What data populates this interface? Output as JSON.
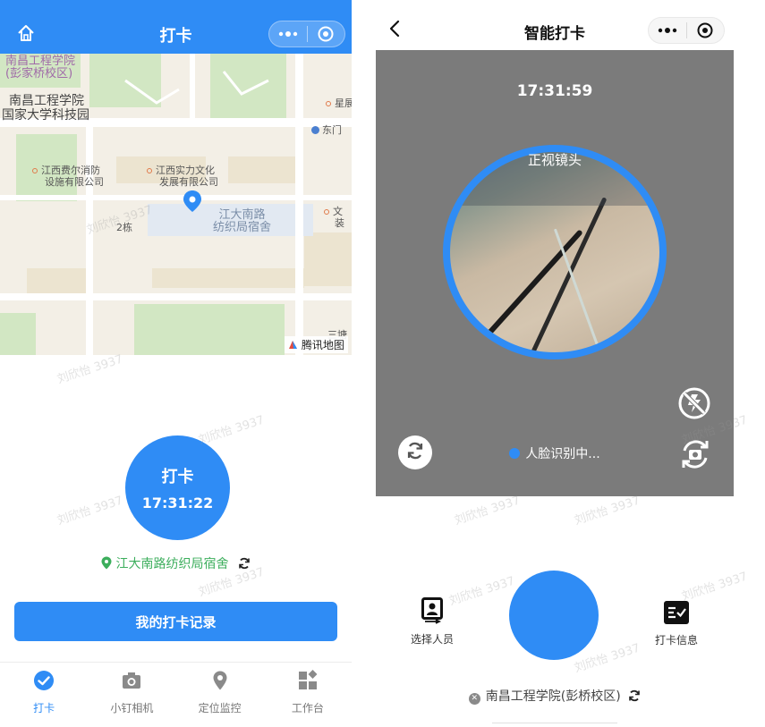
{
  "left": {
    "header": {
      "title": "打卡"
    },
    "map": {
      "labels": {
        "school_top": "南昌工程学院",
        "school_top_sub": "(彭家桥校区)",
        "school": "南昌工程学院",
        "science_park": "国家大学科技园",
        "fire_company_1": "江西费尔消防",
        "fire_company_2": "设施有限公司",
        "culture_company_1": "江西实力文化",
        "culture_company_2": "发展有限公司",
        "dorm_1": "江大南路",
        "dorm_2": "纺织局宿舍",
        "building": "2栋",
        "east_gate": "东门",
        "star": "星展",
        "wen_1": "文",
        "wen_2": "装",
        "other": "三塘"
      },
      "provider": "腾讯地图"
    },
    "checkin": {
      "label": "打卡",
      "time": "17:31:22"
    },
    "location": "江大南路纺织局宿舍",
    "records_button": "我的打卡记录",
    "tabs": [
      {
        "label": "打卡",
        "icon": "check-circle-icon",
        "active": true
      },
      {
        "label": "小钉相机",
        "icon": "camera-icon",
        "active": false
      },
      {
        "label": "定位监控",
        "icon": "location-pin-icon",
        "active": false
      },
      {
        "label": "工作台",
        "icon": "workbench-icon",
        "active": false
      }
    ]
  },
  "right": {
    "header": {
      "title": "智能打卡"
    },
    "camera": {
      "time": "17:31:59",
      "lens_label": "正视镜头",
      "status": "人脸识别中..."
    },
    "actions": {
      "select_person": "选择人员",
      "checkin_info": "打卡信息"
    },
    "location": "南昌工程学院(彭桥校区)"
  },
  "watermark": "刘欣怡 3937",
  "colors": {
    "primary": "#2f8cf5",
    "location_green": "#3cae5c",
    "camera_bg": "#7b7b7b"
  }
}
